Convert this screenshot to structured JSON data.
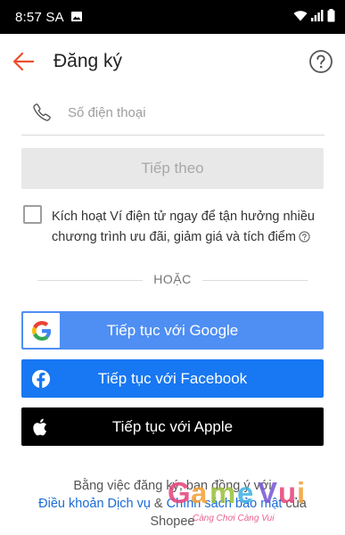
{
  "status_bar": {
    "time": "8:57 SA",
    "icons": [
      "image-icon",
      "wifi-icon",
      "signal-icon",
      "battery-icon"
    ]
  },
  "header": {
    "title": "Đăng ký",
    "back_icon": "arrow-left-icon",
    "help_icon": "question-circle-icon",
    "accent_color": "#ee4d2d"
  },
  "phone": {
    "icon": "phone-icon",
    "placeholder": "Số điện thoại",
    "value": ""
  },
  "next_button": {
    "label": "Tiếp theo"
  },
  "wallet": {
    "checked": false,
    "label": "Kích hoạt Ví điện tử ngay để tận hưởng nhiều chương trình ưu đãi, giảm giá và tích điểm",
    "info_icon": "question-circle-icon"
  },
  "divider": {
    "label": "HOẶC"
  },
  "social": {
    "google": {
      "label": "Tiếp tục với Google",
      "color": "#4f8ef3"
    },
    "facebook": {
      "label": "Tiếp tục với Facebook",
      "color": "#1877f2"
    },
    "apple": {
      "label": "Tiếp tục với Apple",
      "color": "#000000"
    }
  },
  "terms": {
    "prefix": "Bằng việc đăng ký, bạn đồng ý với",
    "link1": "Điều khoản Dịch vụ",
    "conj": " & ",
    "link2": "Chính sách bảo mật",
    "suffix": " của Shopee"
  },
  "watermark": {
    "brand": "GameVui",
    "slogan": "Càng Chơi Càng Vui"
  }
}
